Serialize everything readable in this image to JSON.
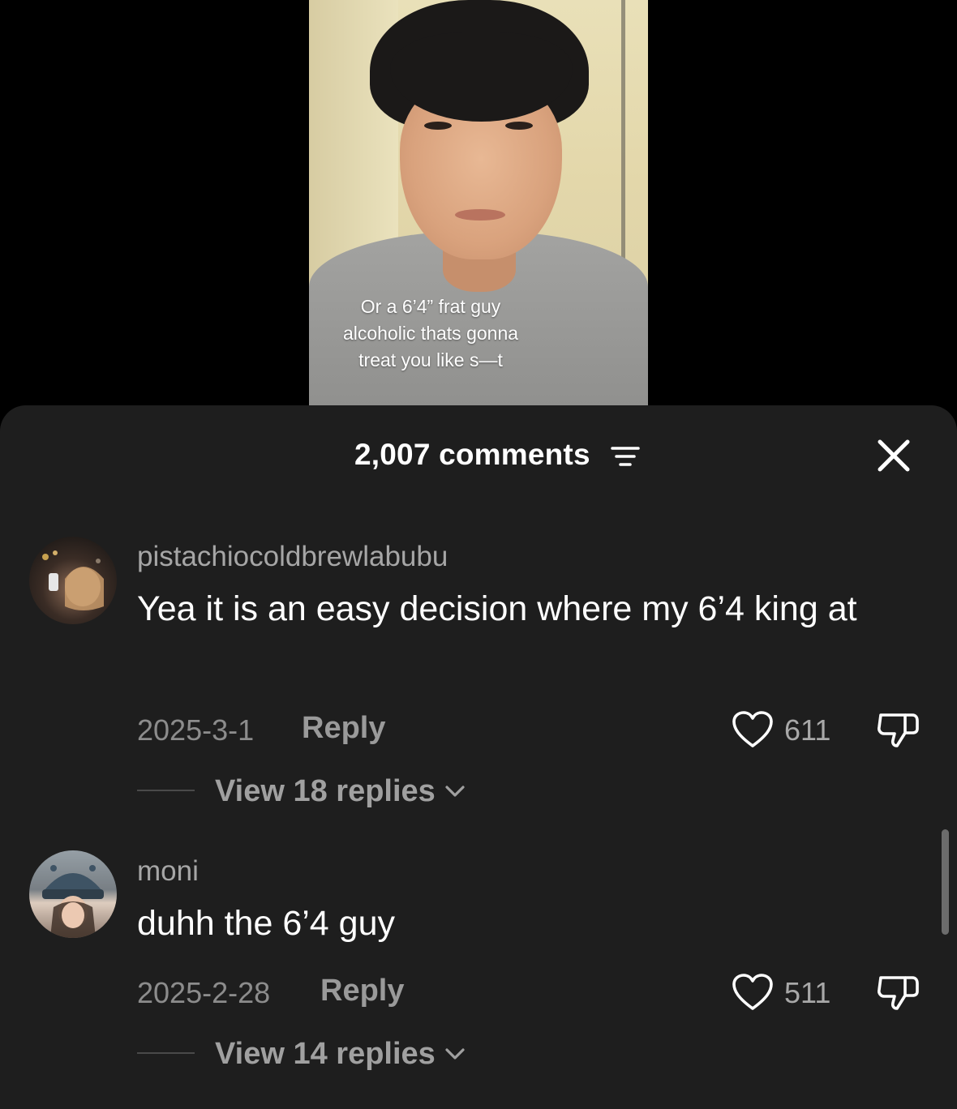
{
  "video": {
    "caption": "Or a 6’4” frat guy\nalcoholic thats gonna\ntreat you like s—t"
  },
  "comments_sheet": {
    "count_label": "2,007 comments",
    "close_icon": "close-icon",
    "filter_icon": "sort-filter-icon"
  },
  "comments": [
    {
      "username": "pistachiocoldbrewlabubu",
      "text": "Yea it is an easy decision where my 6’4 king at",
      "date": "2025-3-1",
      "reply_label": "Reply",
      "likes": "611",
      "view_replies": "View 18 replies"
    },
    {
      "username": "moni",
      "text": "duhh the 6’4 guy",
      "date": "2025-2-28",
      "reply_label": "Reply",
      "likes": "511",
      "view_replies": "View 14 replies"
    }
  ],
  "colors": {
    "sheet_bg": "#1e1e1e",
    "text_primary": "#ffffff",
    "text_secondary": "#a6a6a6"
  }
}
